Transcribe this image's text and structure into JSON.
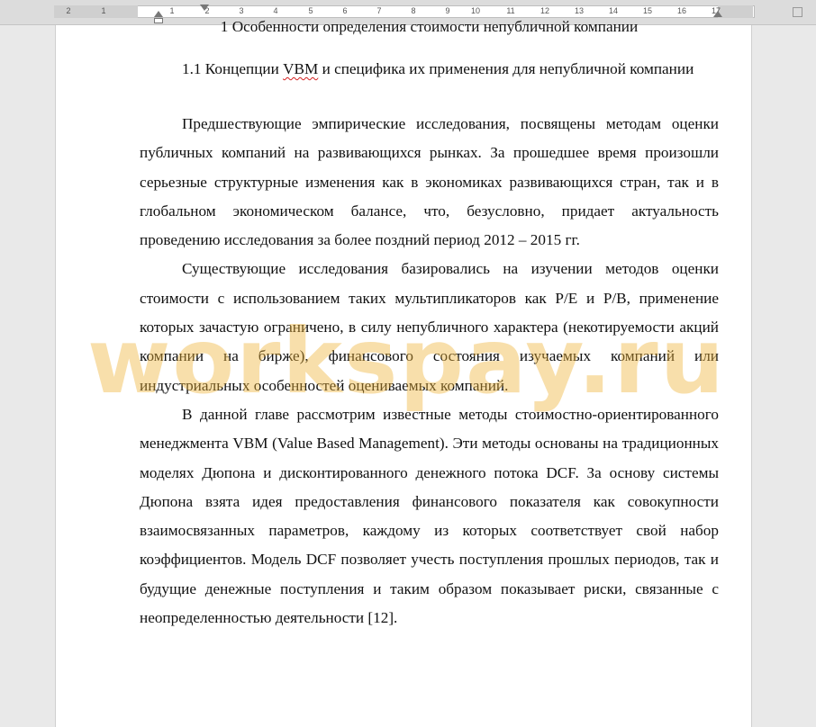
{
  "ruler": {
    "labels": [
      "2",
      "1",
      "1",
      "2",
      "3",
      "4",
      "5",
      "6",
      "7",
      "8",
      "9",
      "10",
      "11",
      "12",
      "13",
      "14",
      "15",
      "16",
      "17"
    ]
  },
  "document": {
    "heading1": "1 Особенности определения стоимости непубличной компании",
    "heading2": {
      "part1": "1.1 Концепции ",
      "abbr": "VBM",
      "part2": " и специфика их применения для непубличной компании"
    },
    "p1": "Предшествующие эмпирические исследования, посвящены методам оценки публичных компаний  на развивающихся рынках. За прошедшее время произошли серьезные структурные изменения как в экономиках развивающихся стран, так и в глобальном экономическом балансе, что, безусловно, придает актуальность проведению исследования за более поздний период 2012 – 2015 гг.",
    "p2": "Существующие исследования базировались на изучении методов оценки стоимости с использованием  таких мультипликаторов как P/E и P/B, применение которых зачастую ограничено, в силу непубличного характера (некотируемости акций компании на бирже), финансового состояния изучаемых компаний или индустриальных особенностей оцениваемых компаний.",
    "p3": "В данной главе рассмотрим известные методы стоимостно-ориентированного менеджмента VBM (Value Based Management). Эти методы основаны на традиционных моделях Дюпона и дисконтированного денежного потока DCF. За основу системы Дюпона взята идея предоставления финансового показателя как совокупности взаимосвязанных параметров, каждому из которых соответствует свой набор коэффициентов. Модель DCF позволяет учесть поступления прошлых периодов, так и будущие денежные поступления и таким образом  показывает риски, связанные с неопределенностью деятельности [12]."
  },
  "watermark": "workspay.ru"
}
